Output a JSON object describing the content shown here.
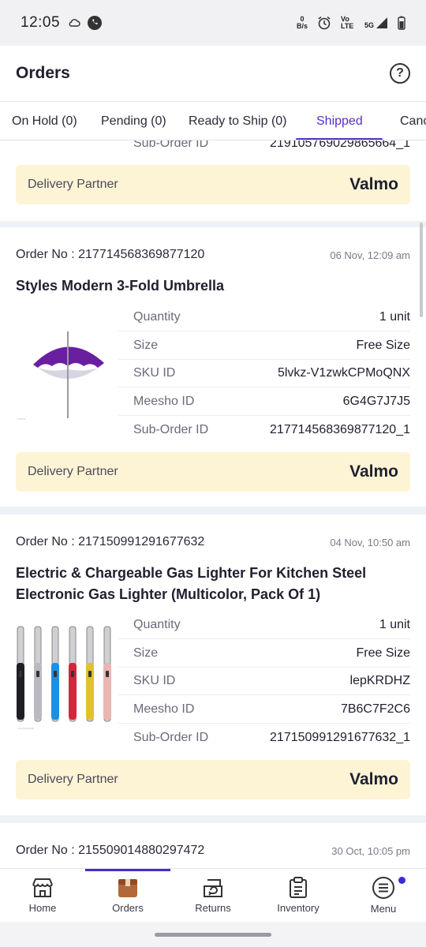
{
  "status_bar": {
    "time": "12:05",
    "net_speed": "0",
    "net_unit": "B/s",
    "volte": "Vo LTE",
    "signal": "5G"
  },
  "header": {
    "title": "Orders",
    "help_symbol": "?"
  },
  "tabs": [
    {
      "label": "On Hold (0)"
    },
    {
      "label": "Pending (0)"
    },
    {
      "label": "Ready to Ship (0)"
    },
    {
      "label": "Shipped"
    },
    {
      "label": "Cancelled"
    }
  ],
  "labels": {
    "quantity": "Quantity",
    "size": "Size",
    "sku_id": "SKU ID",
    "meesho_id": "Meesho ID",
    "sub_order_id": "Sub-Order ID",
    "delivery_partner": "Delivery Partner"
  },
  "partial_card": {
    "sub_order_id": "219105769029865664_1",
    "delivery_partner": "Valmo"
  },
  "orders": [
    {
      "order_no": "Order No : 217714568369877120",
      "date": "06 Nov, 12:09 am",
      "product": "Styles Modern 3-Fold Umbrella",
      "quantity": "1 unit",
      "size": "Free Size",
      "sku": "5lvkz-V1zwkCPMoQNX",
      "meesho_id": "6G4G7J7J5",
      "sub_order_id": "217714568369877120_1",
      "delivery_partner": "Valmo"
    },
    {
      "order_no": "Order No : 217150991291677632",
      "date": "04 Nov, 10:50 am",
      "product": "Electric & Chargeable Gas Lighter For Kitchen Steel Electronic Gas Lighter (Multicolor, Pack Of 1)",
      "quantity": "1 unit",
      "size": "Free Size",
      "sku": "lepKRDHZ",
      "meesho_id": "7B6C7F2C6",
      "sub_order_id": "217150991291677632_1",
      "delivery_partner": "Valmo"
    },
    {
      "order_no": "Order No : 215509014880297472",
      "date": "30 Oct, 10:05 pm"
    }
  ],
  "bottom_nav": [
    {
      "label": "Home",
      "icon": "store-icon"
    },
    {
      "label": "Orders",
      "icon": "box-icon"
    },
    {
      "label": "Returns",
      "icon": "return-box-icon"
    },
    {
      "label": "Inventory",
      "icon": "clipboard-icon"
    },
    {
      "label": "Menu",
      "icon": "menu-icon"
    }
  ],
  "colors": {
    "accent": "#5a2fc7",
    "partner_bg": "#fdf4d6",
    "nav_active": "#4b2bc0",
    "notification_dot": "#3b2bd6"
  }
}
